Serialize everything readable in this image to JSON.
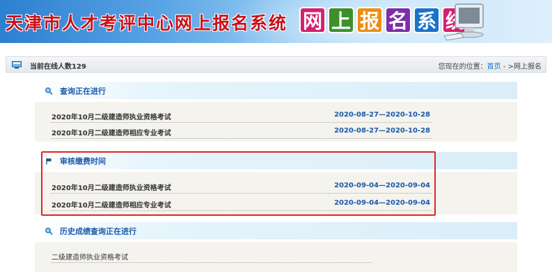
{
  "header": {
    "site_title": "天津市人才考评中心网上报名系统",
    "system_logo_chars": [
      "网",
      "上",
      "报",
      "名",
      "系",
      "统"
    ]
  },
  "statusbar": {
    "online_label": "当前在线人数129",
    "location_prefix": "您现在的位置：",
    "home_link": "首页",
    "location_suffix": " - >网上报名"
  },
  "sections": [
    {
      "title": "查询正在进行",
      "rows": [
        {
          "name": "2020年10月二级建造师执业资格考试",
          "dates": "2020-08-27—2020-10-28"
        },
        {
          "name": "2020年10月二级建造师相应专业考试",
          "dates": "2020-08-27—2020-10-28"
        }
      ]
    },
    {
      "title": "审核缴费时间",
      "rows": [
        {
          "name": "2020年10月二级建造师执业资格考试",
          "dates": "2020-09-04—2020-09-04"
        },
        {
          "name": "2020年10月二级建造师相应专业考试",
          "dates": "2020-09-04—2020-09-04"
        }
      ]
    },
    {
      "title": "历史成绩查询正在进行",
      "rows": [
        {
          "name": "二级建造师执业资格考试",
          "dates": ""
        }
      ]
    }
  ],
  "colors": {
    "title_red": "#c8101a",
    "link_blue": "#1a5aa8",
    "highlight_red": "#e02424",
    "section_bg": "#f4f3ee"
  },
  "icons": {
    "status": "monitor-icon",
    "section_1": "magnifier-icon",
    "section_2": "flag-icon",
    "section_3": "magnifier-icon"
  }
}
